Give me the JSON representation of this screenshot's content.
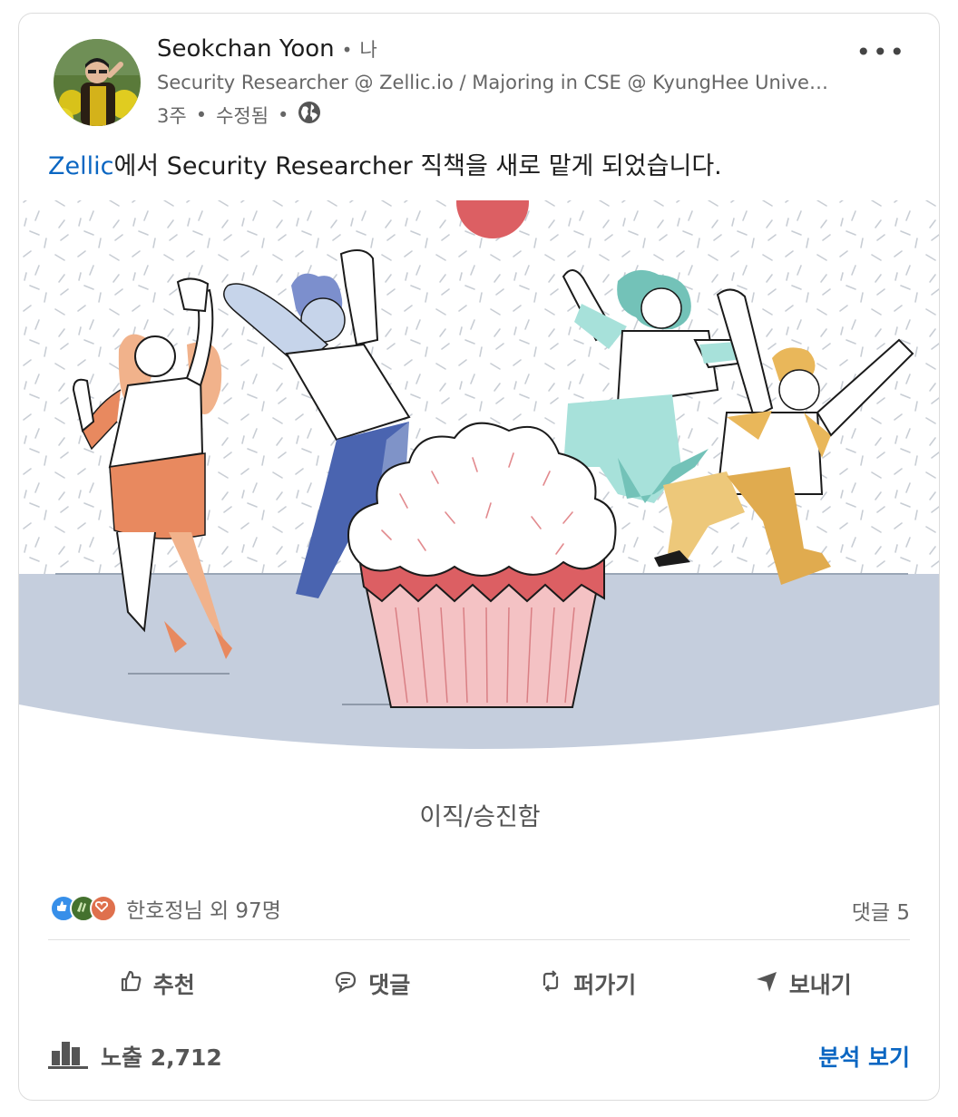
{
  "post": {
    "author_name": "Seokchan Yoon",
    "connection_degree": "나",
    "headline": "Security Researcher @ Zellic.io / Majoring in CSE @ KyungHee Universit…",
    "time": "3주",
    "edited": "수정됨",
    "visibility_icon": "globe-icon",
    "more_label": "•••",
    "text_mention": "Zellic",
    "text_body": "에서 Security Researcher 직책을 새로 맡게 되었습니다.",
    "image_caption": "이직/승진함"
  },
  "social": {
    "reactions_text": "한호정님 외 97명",
    "reaction_icons": [
      "like-icon",
      "celebrate-icon",
      "love-icon"
    ],
    "comments_text": "댓글 5"
  },
  "actions": [
    {
      "label": "추천",
      "icon": "thumbs-up-icon"
    },
    {
      "label": "댓글",
      "icon": "comment-icon"
    },
    {
      "label": "퍼가기",
      "icon": "repost-icon"
    },
    {
      "label": "보내기",
      "icon": "send-icon"
    }
  ],
  "footer": {
    "impressions": "노출 2,712",
    "analytics_link": "분석 보기"
  },
  "colors": {
    "accent": "#0a66c2",
    "ground": "#c5cedd",
    "cupcake": "#dc5f63"
  }
}
